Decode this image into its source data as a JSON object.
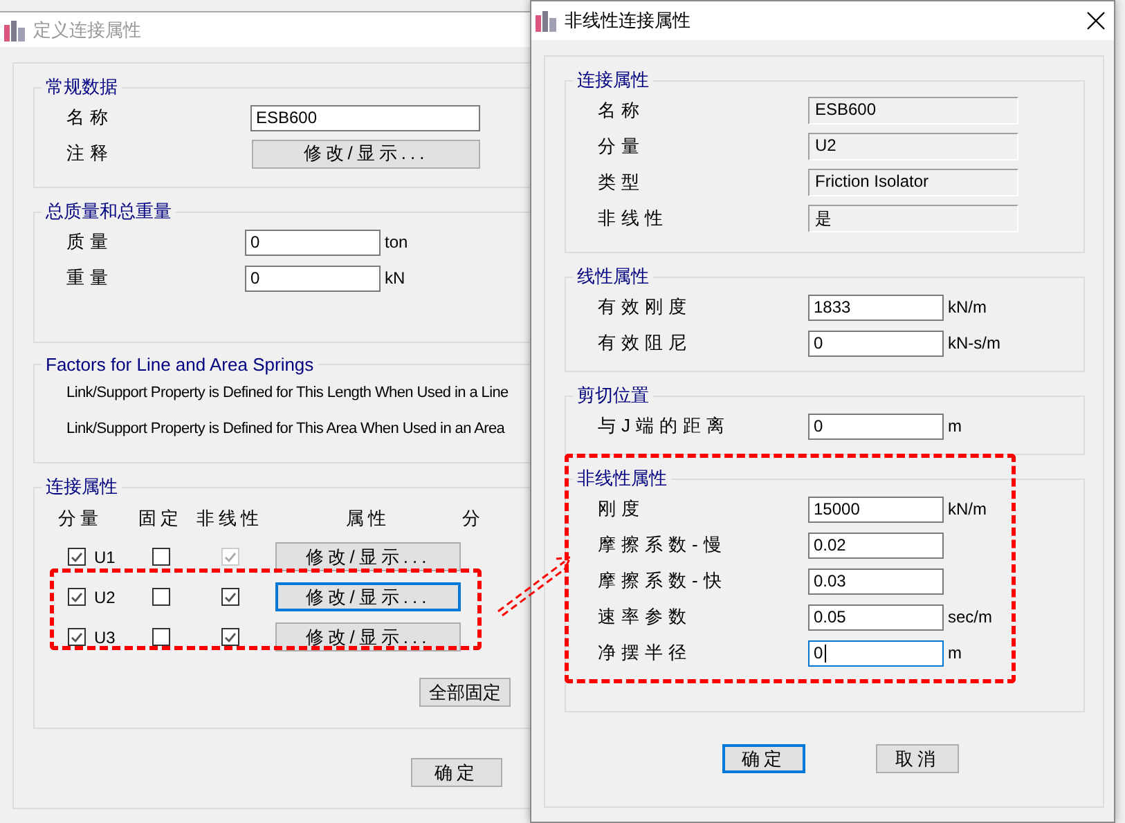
{
  "main_window": {
    "title": "定义连接属性",
    "general": {
      "title": "常规数据",
      "name_label": "名称",
      "name_value": "ESB600",
      "notes_label": "注释",
      "notes_button": "修改/显示..."
    },
    "mass": {
      "title": "总质量和总重量",
      "rows": [
        {
          "label": "质量",
          "value": "0",
          "unit": "ton"
        },
        {
          "label": "重量",
          "value": "0",
          "unit": "kN"
        }
      ]
    },
    "factors": {
      "title": "Factors for Line and Area Springs",
      "lines": [
        "Link/Support Property is Defined for This Length When Used in a Line",
        "Link/Support Property is Defined for This Area When Used in an Area"
      ]
    },
    "link_props": {
      "title": "连接属性",
      "columns": [
        "分量",
        "固定",
        "非线性",
        "属性",
        "分"
      ],
      "rows": [
        {
          "label": "U1",
          "checked": true,
          "fixed": false,
          "nonlinear": true,
          "nonlinear_disabled": true,
          "button": "修改/显示...",
          "focused": false
        },
        {
          "label": "U2",
          "checked": true,
          "fixed": false,
          "nonlinear": true,
          "nonlinear_disabled": false,
          "button": "修改/显示...",
          "focused": true
        },
        {
          "label": "U3",
          "checked": true,
          "fixed": false,
          "nonlinear": true,
          "nonlinear_disabled": false,
          "button": "修改/显示...",
          "focused": false
        }
      ],
      "fix_all_button": "全部固定"
    },
    "ok_button": "确定"
  },
  "dialog": {
    "title": "非线性连接属性",
    "groups": [
      {
        "title": "连接属性",
        "rows": [
          {
            "kind": "readonly",
            "label": "名称",
            "value": "ESB600"
          },
          {
            "kind": "readonly",
            "label": "分量",
            "value": "U2"
          },
          {
            "kind": "readonly",
            "label": "类型",
            "value": "Friction Isolator"
          },
          {
            "kind": "readonly",
            "label": "非线性",
            "value": "是"
          }
        ]
      },
      {
        "title": "线性属性",
        "rows": [
          {
            "kind": "input",
            "label": "有效刚度",
            "value": "1833",
            "unit": "kN/m",
            "focused": false
          },
          {
            "kind": "input",
            "label": "有效阻尼",
            "value": "0",
            "unit": "kN-s/m",
            "focused": false
          }
        ]
      },
      {
        "title": "剪切位置",
        "rows": [
          {
            "kind": "input",
            "label": "与J端的距离",
            "value": "0",
            "unit": "m",
            "focused": false
          }
        ]
      },
      {
        "title": "非线性属性",
        "rows": [
          {
            "kind": "input",
            "label": "刚度",
            "value": "15000",
            "unit": "kN/m",
            "focused": false
          },
          {
            "kind": "input",
            "label": "摩擦系数-慢",
            "value": "0.02",
            "focused": false
          },
          {
            "kind": "input",
            "label": "摩擦系数-快",
            "value": "0.03",
            "focused": false
          },
          {
            "kind": "input",
            "label": "速率参数",
            "value": "0.05",
            "unit": "sec/m",
            "focused": false
          },
          {
            "kind": "input",
            "label": "净摆半径",
            "value": "0",
            "unit": "m",
            "focused": true
          }
        ]
      }
    ],
    "buttons": [
      {
        "label": "确定",
        "focused": true
      },
      {
        "label": "取消",
        "focused": false
      }
    ]
  }
}
